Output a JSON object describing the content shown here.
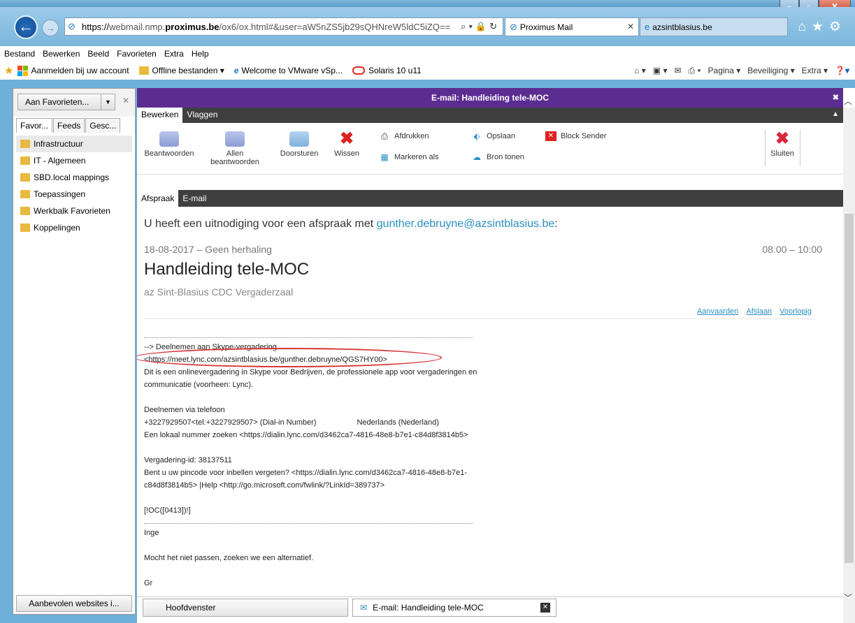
{
  "browser": {
    "url_prefix": "https://",
    "url_host_pre": "webmail.nmp.",
    "url_host": "proximus.be",
    "url_rest": "/ox6/ox.html#&user=aW5nZS5jb29sQHNreW5ldC5iZQ==",
    "tabs": [
      {
        "label": "Proximus Mail"
      },
      {
        "label": "azsintblasius.be"
      }
    ],
    "menu": [
      "Bestand",
      "Bewerken",
      "Beeld",
      "Favorieten",
      "Extra",
      "Help"
    ],
    "favorites_bar": [
      {
        "label": "Aanmelden bij uw account"
      },
      {
        "label": "Offline bestanden ▾"
      },
      {
        "label": "Welcome to VMware vSp..."
      },
      {
        "label": "Solaris 10 u11"
      }
    ],
    "command_bar": [
      "Pagina ▾",
      "Beveiliging ▾",
      "Extra ▾"
    ]
  },
  "sidebar": {
    "add_button": "Aan Favorieten...",
    "tabs": [
      "Favor...",
      "Feeds",
      "Gesc..."
    ],
    "items": [
      {
        "label": "Infrastructuur"
      },
      {
        "label": "IT - Algemeen"
      },
      {
        "label": "SBD.local mappings"
      },
      {
        "label": "Toepassingen"
      },
      {
        "label": "Werkbalk Favorieten"
      },
      {
        "label": "Koppelingen"
      }
    ],
    "bottom_button": "Aanbevolen websites i..."
  },
  "window_title": "E-mail: Handleiding tele-MOC",
  "ribbon": {
    "tabs": [
      "Bewerken",
      "Vlaggen"
    ],
    "big_buttons": {
      "reply": "Beantwoorden",
      "reply_all_1": "Allen",
      "reply_all_2": "beantwoorden",
      "forward": "Doorsturen",
      "delete": "Wissen",
      "close": "Sluiten"
    },
    "small_buttons": {
      "print": "Afdrukken",
      "mark": "Markeren als",
      "save": "Opslaan",
      "source": "Bron tonen",
      "block": "Block Sender"
    }
  },
  "view_tabs": [
    "Afspraak",
    "E-mail"
  ],
  "appointment": {
    "invite_prefix": "U heeft een uitnodiging voor een afspraak met ",
    "invite_email": "gunther.debruyne@azsintblasius.be",
    "invite_suffix": ":",
    "date": "18-08-2017 – Geen herhaling",
    "time": "08:00 – 10:00",
    "subject": "Handleiding tele-MOC",
    "location": "az Sint-Blasius CDC Vergaderzaal",
    "actions": [
      "Aanvaarden",
      "Afslaan",
      "Voorlopig"
    ]
  },
  "body": {
    "skype_join": "--> Deelnemen aan Skype-vergadering",
    "skype_link": "<https://meet.lync.com/azsintblasius.be/gunther.debruyne/QGS7HY00>",
    "desc_1": "Dit is een onlinevergadering in Skype voor Bedrijven, de professionele app voor vergaderingen en",
    "desc_2": "communicatie (voorheen: Lync).",
    "phone_title": "Deelnemen via telefoon",
    "phone_number": "+3227929507<tel:+3227929507> (Dial-in Number)",
    "phone_lang": "Nederlands (Nederland)",
    "local_number": "Een lokaal nummer zoeken <https://dialin.lync.com/d3462ca7-4816-48e8-b7e1-c84d8f3814b5>",
    "meeting_id": "Vergadering-id: 38137511",
    "pin_1": " Bent u uw pincode voor inbellen vergeten? <https://dialin.lync.com/d3462ca7-4816-48e8-b7e1-",
    "pin_2": "c84d8f3814b5>  |Help <http://go.microsoft.com/fwlink/?LinkId=389737>",
    "code": "[!OC([0413])!]",
    "sign": "Inge",
    "alt": "Mocht het niet passen, zoeken we een alternatief.",
    "greet": "Gr"
  },
  "bottom_tabs": [
    "Hoofdvenster",
    "E-mail: Handleiding tele-MOC"
  ]
}
